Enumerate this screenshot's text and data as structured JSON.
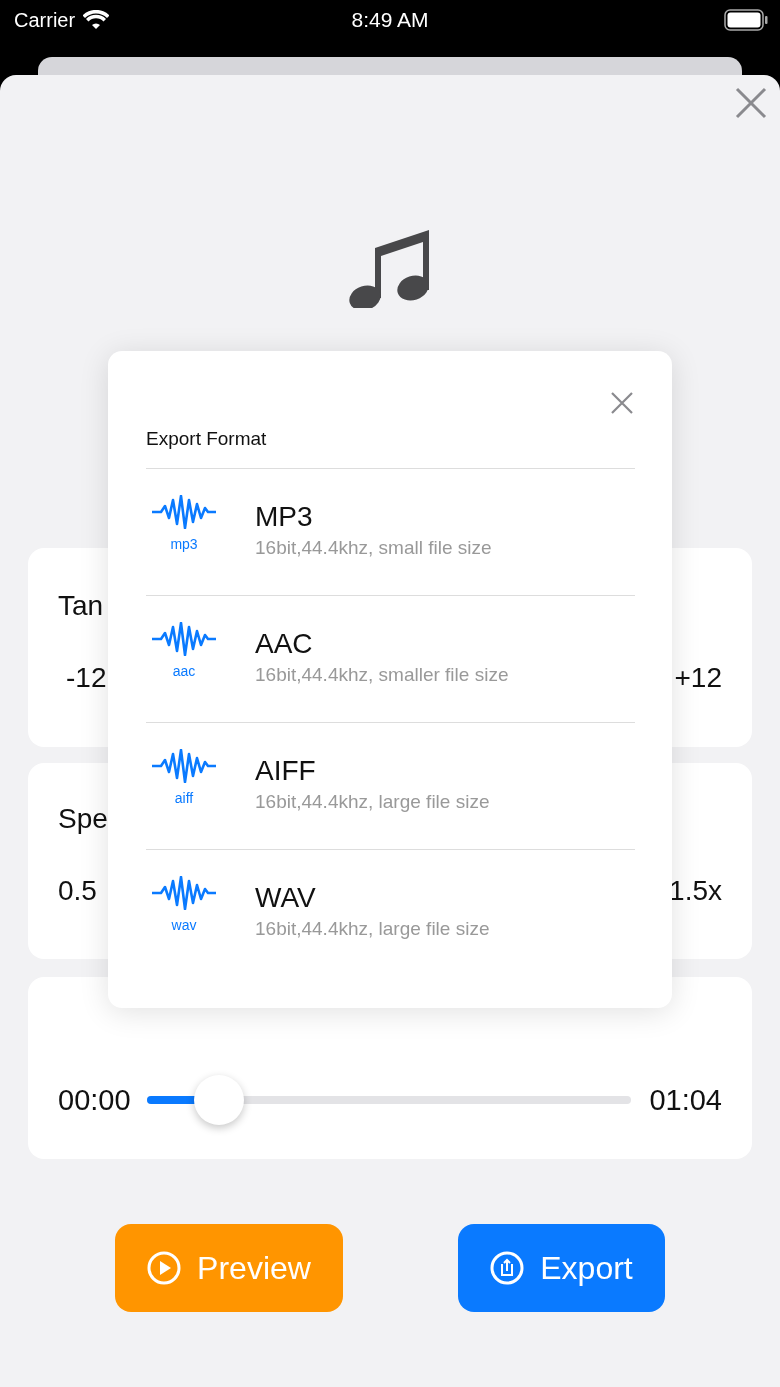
{
  "status_bar": {
    "carrier": "Carrier",
    "time": "8:49 AM"
  },
  "tempo_card": {
    "title": "Tan",
    "min": "-12",
    "max": "+12"
  },
  "speed_card": {
    "title": "Spe",
    "min": "0.5",
    "max": "1.5x"
  },
  "player": {
    "start": "00:00",
    "end": "01:04",
    "level": 0.15
  },
  "buttons": [
    {
      "kind": "preview",
      "label": "Preview"
    },
    {
      "kind": "export",
      "label": "Export"
    }
  ],
  "dialog": {
    "title": "Export Format",
    "formats": [
      {
        "name": "MP3",
        "tag": "mp3",
        "detail": "16bit,44.4khz, small file size"
      },
      {
        "name": "AAC",
        "tag": "aac",
        "detail": "16bit,44.4khz, smaller file size"
      },
      {
        "name": "AIFF",
        "tag": "aiff",
        "detail": "16bit,44.4khz, large file size"
      },
      {
        "name": "WAV",
        "tag": "wav",
        "detail": "16bit,44.4khz, large file size"
      }
    ]
  }
}
